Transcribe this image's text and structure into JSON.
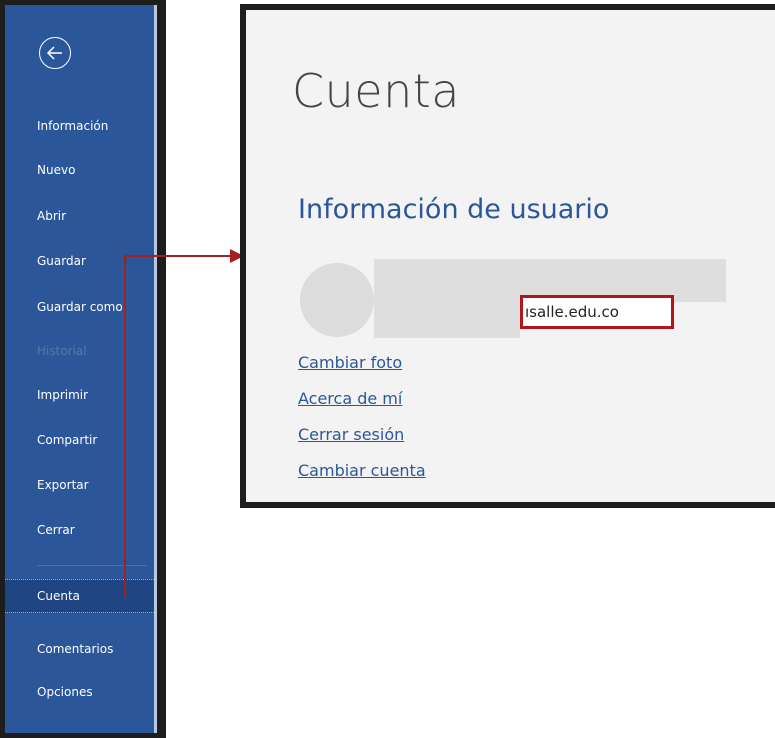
{
  "sidebar": {
    "back_label": "",
    "items": [
      {
        "label": "Información"
      },
      {
        "label": "Nuevo"
      },
      {
        "label": "Abrir"
      },
      {
        "label": "Guardar"
      },
      {
        "label": "Guardar como"
      },
      {
        "label": "Historial",
        "disabled": true
      },
      {
        "label": "Imprimir"
      },
      {
        "label": "Compartir"
      },
      {
        "label": "Exportar"
      },
      {
        "label": "Cerrar"
      },
      {
        "label": "Cuenta",
        "active": true
      },
      {
        "label": "Comentarios"
      },
      {
        "label": "Opciones"
      }
    ]
  },
  "account": {
    "title": "Cuenta",
    "section_title": "Información de usuario",
    "email_visible": "ısalle.edu.co",
    "links": {
      "change_photo": "Cambiar foto",
      "about_me": "Acerca de mí",
      "sign_out": "Cerrar sesión",
      "switch_account": "Cambiar cuenta"
    }
  },
  "colors": {
    "sidebar_bg": "#2b579a",
    "highlight_red": "#b2151c",
    "link_blue": "#2b579a",
    "panel_bg": "#f3f3f3"
  }
}
